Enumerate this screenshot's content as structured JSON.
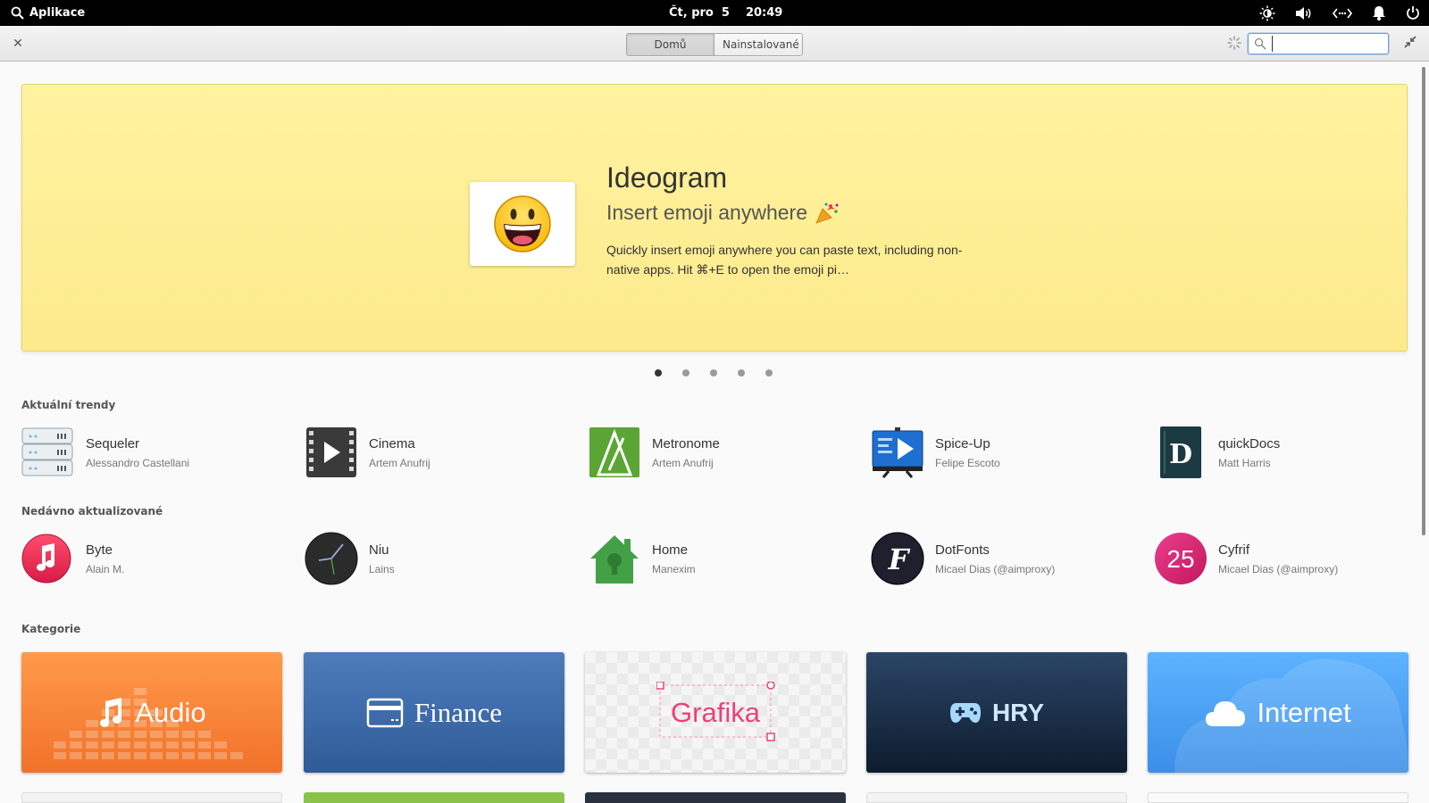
{
  "panel": {
    "apps_label": "Aplikace",
    "date": "Čt, pro  5",
    "time": "20:49"
  },
  "header": {
    "mode_home": "Domů",
    "mode_installed": "Nainstalované",
    "search_placeholder": ""
  },
  "banner": {
    "title": "Ideogram",
    "subtitle": "Insert emoji anywhere",
    "description": "Quickly insert emoji anywhere you can paste text, including non-native apps. Hit ⌘+E to open the emoji pi…",
    "background": "#fdf08f",
    "pages": 5,
    "active_page": 1
  },
  "trending": {
    "label": "Aktuální trendy",
    "apps": [
      {
        "name": "Sequeler",
        "author": "Alessandro Castellani",
        "icon": "sequeler-icon"
      },
      {
        "name": "Cinema",
        "author": "Artem Anufrij",
        "icon": "cinema-icon"
      },
      {
        "name": "Metronome",
        "author": "Artem Anufrij",
        "icon": "metronome-icon"
      },
      {
        "name": "Spice-Up",
        "author": "Felipe Escoto",
        "icon": "spice-up-icon"
      },
      {
        "name": "quickDocs",
        "author": "Matt Harris",
        "icon": "quickdocs-icon"
      }
    ]
  },
  "recent": {
    "label": "Nedávno aktualizované",
    "apps": [
      {
        "name": "Byte",
        "author": "Alain M.",
        "icon": "byte-icon"
      },
      {
        "name": "Niu",
        "author": "Lains",
        "icon": "niu-icon"
      },
      {
        "name": "Home",
        "author": "Manexim",
        "icon": "home-icon"
      },
      {
        "name": "DotFonts",
        "author": "Micael Dias (@aimproxy)",
        "icon": "dotfonts-icon"
      },
      {
        "name": "Cyfrif",
        "author": "Micael Dias (@aimproxy)",
        "icon": "cyfrif-icon",
        "icon_text": "25"
      }
    ]
  },
  "categories": {
    "label": "Kategorie",
    "items": [
      {
        "label": "Audio",
        "icon": "music-note-icon",
        "color": "#f7823a"
      },
      {
        "label": "Finance",
        "icon": "credit-card-icon",
        "color": "#3b67a6"
      },
      {
        "label": "Grafika",
        "icon": "",
        "color": "#ec407a"
      },
      {
        "label": "HRY",
        "icon": "gamepad-icon",
        "color": "#1b2f4a"
      },
      {
        "label": "Internet",
        "icon": "cloud-icon",
        "color": "#4aa0f5"
      }
    ]
  }
}
